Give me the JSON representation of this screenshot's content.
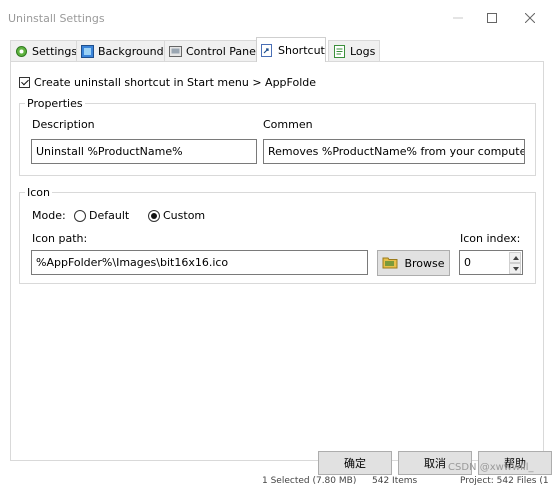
{
  "window": {
    "title": "Uninstall Settings"
  },
  "tabs": [
    {
      "label": "Settings",
      "icon": "settings-tab-icon"
    },
    {
      "label": "Background",
      "icon": "background-tab-icon"
    },
    {
      "label": "Control Panel",
      "icon": "control-panel-tab-icon"
    },
    {
      "label": "Shortcut",
      "icon": "shortcut-tab-icon",
      "active": true
    },
    {
      "label": "Logs",
      "icon": "logs-tab-icon"
    }
  ],
  "shortcut": {
    "create_shortcut_label": "Create uninstall shortcut in Start menu > AppFolde",
    "create_shortcut_checked": true,
    "properties": {
      "legend": "Properties",
      "description_label": "Description",
      "description_value": "Uninstall %ProductName%",
      "comment_label": "Commen",
      "comment_value": "Removes %ProductName% from your computer."
    },
    "icon": {
      "legend": "Icon",
      "mode_label": "Mode:",
      "mode_default_label": "Default",
      "mode_custom_label": "Custom",
      "mode_selected": "Custom",
      "icon_path_label": "Icon path:",
      "icon_path_value": "%AppFolder%\\Images\\bit16x16.ico",
      "browse_label": "Browse",
      "icon_index_label": "Icon index:",
      "icon_index_value": "0"
    }
  },
  "dialog_buttons": {
    "ok": "确定",
    "cancel": "取消",
    "help": "帮助"
  },
  "status": {
    "selection": "1 Selected (7.80 MB)",
    "items": "542 Items",
    "project": "Project: 542 Files (1"
  },
  "watermark": "CSDN @xwwwill_",
  "colors": {
    "tab_border": "#d9d9d9",
    "button_face": "#e1e1e1",
    "field_border": "#7a7a7a"
  }
}
